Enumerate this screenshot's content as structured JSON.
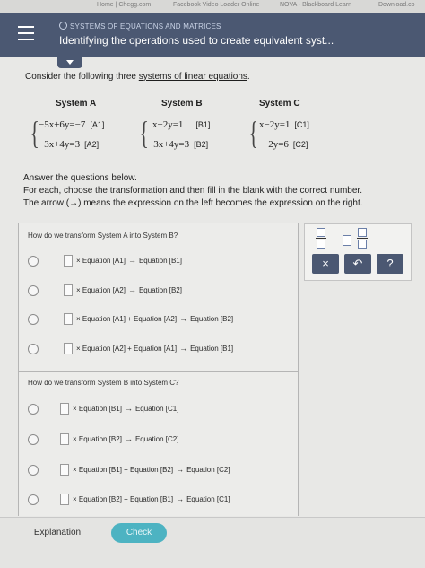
{
  "browser_bookmarks": [
    "Home | Chegg.com",
    "Facebook Video Loader Online",
    "NOVA - Blackboard Learn",
    "Download.co"
  ],
  "header": {
    "breadcrumb": "SYSTEMS OF EQUATIONS AND MATRICES",
    "title": "Identifying the operations used to create equivalent syst..."
  },
  "intro": {
    "before": "Consider the following three ",
    "link": "systems of linear equations",
    "after": "."
  },
  "systems": [
    {
      "name": "System A",
      "eqs": [
        {
          "expr": "−5x+6y=−7",
          "tag": "[A1]"
        },
        {
          "expr": "−3x+4y=3",
          "tag": "[A2]"
        }
      ]
    },
    {
      "name": "System B",
      "eqs": [
        {
          "expr": "x−2y=1",
          "tag": "[B1]"
        },
        {
          "expr": "−3x+4y=3",
          "tag": "[B2]"
        }
      ]
    },
    {
      "name": "System C",
      "eqs": [
        {
          "expr": "x−2y=1",
          "tag": "[C1]"
        },
        {
          "expr": "−2y=6",
          "tag": "[C2]"
        }
      ]
    }
  ],
  "instructions": {
    "line1": "Answer the questions below.",
    "line2": "For each, choose the transformation and then fill in the blank with the correct number.",
    "line3": "The arrow (→) means the expression on the left becomes the expression on the right."
  },
  "question1": {
    "prompt": "How do we transform System A into System B?",
    "options": [
      {
        "pre": "× Equation [A1]",
        "arrow": "→",
        "post": "Equation [B1]"
      },
      {
        "pre": "× Equation [A2]",
        "arrow": "→",
        "post": "Equation [B2]"
      },
      {
        "pre": "× Equation [A1] + Equation [A2]",
        "arrow": "→",
        "post": "Equation [B2]"
      },
      {
        "pre": "× Equation [A2] + Equation [A1]",
        "arrow": "→",
        "post": "Equation [B1]"
      }
    ]
  },
  "question2": {
    "prompt": "How do we transform System B into System C?",
    "options": [
      {
        "pre": "× Equation [B1]",
        "arrow": "→",
        "post": "Equation [C1]"
      },
      {
        "pre": "× Equation [B2]",
        "arrow": "→",
        "post": "Equation [C2]"
      },
      {
        "pre": "× Equation [B1] + Equation [B2]",
        "arrow": "→",
        "post": "Equation [C2]"
      },
      {
        "pre": "× Equation [B2] + Equation [B1]",
        "arrow": "→",
        "post": "Equation [C1]"
      }
    ]
  },
  "tools": {
    "clear": "×",
    "undo": "↶",
    "help": "?"
  },
  "footer": {
    "explanation": "Explanation",
    "check": "Check"
  },
  "colors": {
    "header_bg": "#4b5872",
    "check_bg": "#4db3c2",
    "tool_bg": "#4b5872"
  },
  "icons": [
    "menu-icon",
    "chevron-down-icon",
    "fraction-icon",
    "mixed-number-icon",
    "close-icon",
    "undo-icon",
    "help-icon"
  ]
}
